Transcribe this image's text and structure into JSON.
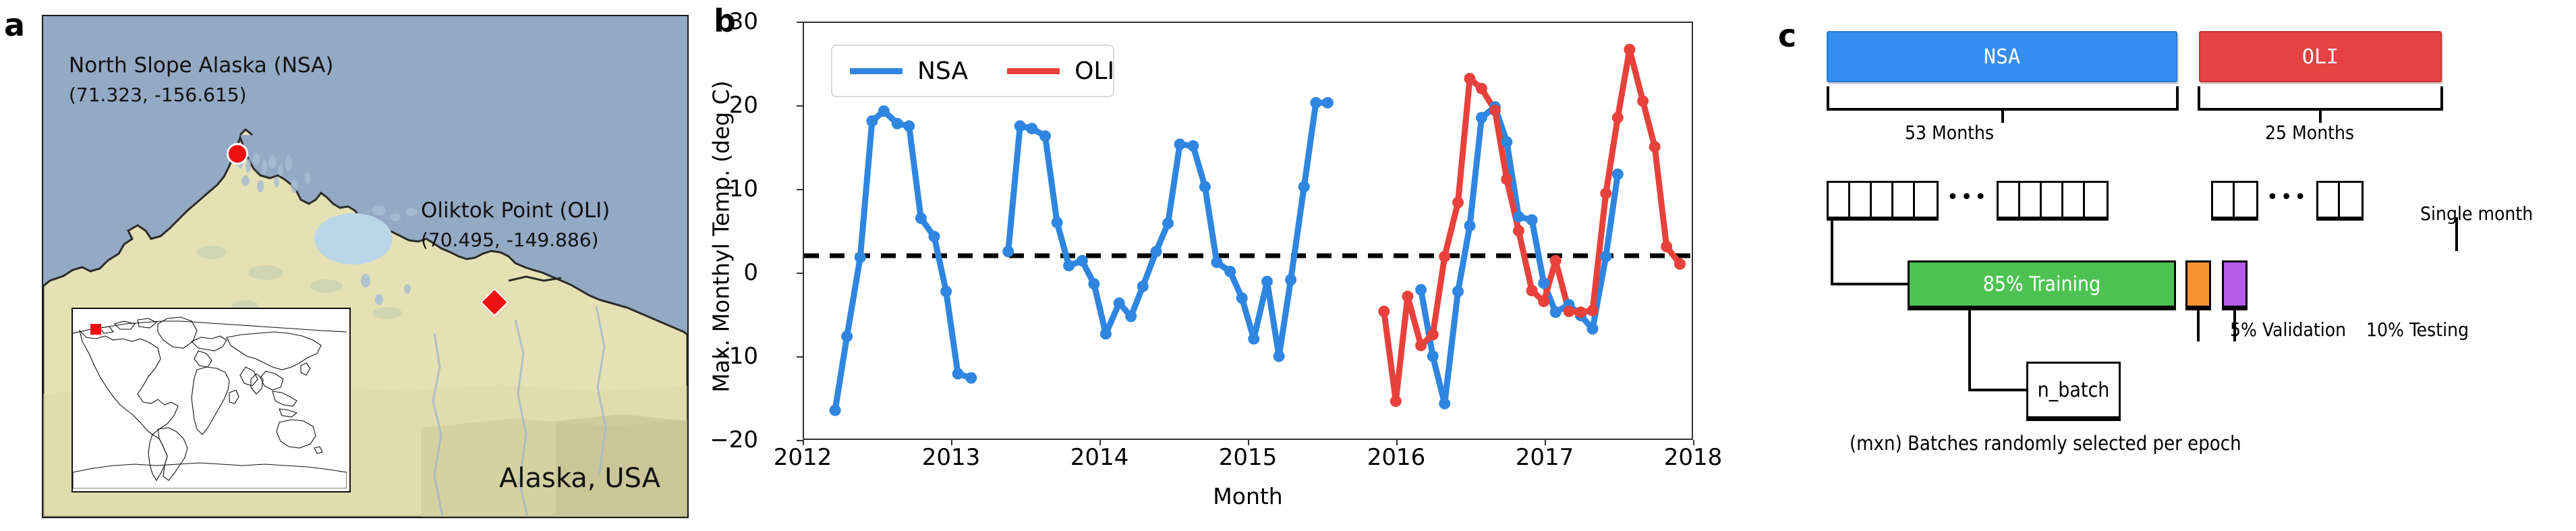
{
  "panels": {
    "a": {
      "letter": "a"
    },
    "b": {
      "letter": "b"
    },
    "c": {
      "letter": "c"
    }
  },
  "map": {
    "nsa_name": "North Slope Alaska (NSA)",
    "nsa_coord": "(71.323, -156.615)",
    "oli_name": "Oliktok Point (OLI)",
    "oli_coord": "(70.495, -149.886)",
    "region_label": "Alaska, USA",
    "ocean_color": "#93a9c4",
    "land_color": "#e6e1b4",
    "lake_color": "#b8d6e8",
    "marker_color": "#ee1111"
  },
  "chart_data": {
    "type": "line",
    "title": "",
    "xlabel": "Month",
    "ylabel": "Max. Monthyl Temp. (deg C)",
    "xlim": [
      2012,
      2018
    ],
    "ylim": [
      -20,
      30
    ],
    "xticks": [
      "2012",
      "2013",
      "2014",
      "2015",
      "2016",
      "2017",
      "2018"
    ],
    "yticks": [
      "30",
      "20",
      "10",
      "0",
      "−10",
      "−20"
    ],
    "grid": false,
    "legend_position": "upper-left",
    "annotations": [
      {
        "type": "hline",
        "y": 2.0,
        "style": "dashed",
        "color": "#000000"
      }
    ],
    "series": [
      {
        "name": "NSA",
        "color": "#2e86e0",
        "x": [
          2012.21,
          2012.29,
          2012.38,
          2012.46,
          2012.54,
          2012.63,
          2012.71,
          2012.79,
          2012.88,
          2012.96,
          2013.04,
          2013.13,
          2013.38,
          2013.46,
          2013.54,
          2013.63,
          2013.71,
          2013.79,
          2013.88,
          2013.96,
          2014.04,
          2014.13,
          2014.21,
          2014.29,
          2014.38,
          2014.46,
          2014.54,
          2014.63,
          2014.71,
          2014.79,
          2014.88,
          2014.96,
          2015.04,
          2015.13,
          2015.21,
          2015.29,
          2015.38,
          2015.46,
          2015.54,
          2016.17,
          2016.25,
          2016.33,
          2016.42,
          2016.5,
          2016.58,
          2016.67,
          2016.75,
          2016.83,
          2016.92,
          2017.0,
          2017.08,
          2017.17,
          2017.25,
          2017.33,
          2017.42,
          2017.5
        ],
        "y": [
          -16.6,
          -7.7,
          1.8,
          18.2,
          19.4,
          17.9,
          17.6,
          6.5,
          4.3,
          -2.3,
          -12.2,
          -12.7,
          2.5,
          17.6,
          17.3,
          16.4,
          6.0,
          0.8,
          1.4,
          -1.4,
          -7.4,
          -3.7,
          -5.3,
          -1.7,
          2.5,
          5.9,
          15.4,
          15.2,
          10.3,
          1.2,
          0.1,
          -3.1,
          -8.0,
          -1.1,
          -10.1,
          -0.9,
          10.3,
          20.4,
          20.4,
          -2.1,
          -10.1,
          -15.8,
          -2.3,
          5.6,
          18.6,
          19.9,
          15.7,
          6.7,
          6.3,
          -1.3,
          -4.8,
          -3.9,
          -5.2,
          -6.8,
          1.9,
          11.8
        ]
      },
      {
        "name": "OLI",
        "color": "#e8413c",
        "x": [
          2015.92,
          2016.0,
          2016.08,
          2016.17,
          2016.25,
          2016.33,
          2016.42,
          2016.5,
          2016.58,
          2016.67,
          2016.75,
          2016.83,
          2016.92,
          2017.0,
          2017.08,
          2017.17,
          2017.25,
          2017.33,
          2017.42,
          2017.5,
          2017.58,
          2017.67,
          2017.75,
          2017.83,
          2017.92
        ],
        "y": [
          -4.7,
          -15.5,
          -2.9,
          -8.8,
          -7.5,
          1.9,
          8.4,
          23.3,
          22.1,
          19.5,
          11.2,
          5.0,
          -2.2,
          -3.5,
          1.4,
          -4.7,
          -4.8,
          -4.6,
          9.5,
          18.6,
          26.8,
          20.6,
          15.1,
          3.1,
          1.0
        ]
      }
    ]
  },
  "legend": {
    "items": [
      {
        "label": "NSA",
        "color": "#2e86e0"
      },
      {
        "label": "OLI",
        "color": "#e8413c"
      }
    ]
  },
  "pipeline": {
    "nsa_box_label": "NSA",
    "oli_box_label": "OLI",
    "nsa_box_color": "#338eef",
    "oli_box_color": "#e54343",
    "nsa_months": "53 Months",
    "oli_months": "25 Months",
    "single_month": "Single month",
    "nsa_cells_left": 5,
    "nsa_cells_right": 5,
    "oli_cells_left": 2,
    "oli_cells_right": 2,
    "ellipsis": "•••",
    "training_label": "85% Training",
    "training_color": "#4dc253",
    "validation_label": "5% Validation",
    "validation_color": "#f79433",
    "testing_label": "10% Testing",
    "testing_color": "#b45ce8",
    "batch_label": "n_batch",
    "caption": "(mxn) Batches randomly selected per epoch"
  }
}
